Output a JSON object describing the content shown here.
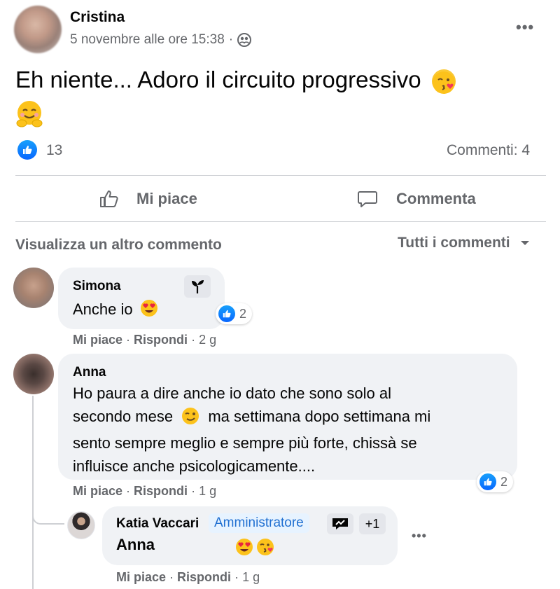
{
  "post": {
    "author": "Cristina",
    "date": "5 novembre alle ore 15:38",
    "separator": "·",
    "text_line1": "Eh niente... Adoro il circuito progressivo",
    "like_count": "13",
    "comments_count": "Commenti: 4",
    "icons": {
      "audience": "friends-icon",
      "more": "more-icon",
      "like": "like-icon"
    }
  },
  "actions": {
    "like_label": "Mi piace",
    "comment_label": "Commenta"
  },
  "comments_header": {
    "view_more": "Visualizza un altro commento",
    "filter": "Tutti i commenti"
  },
  "comments": [
    {
      "author": "Simona",
      "text": "Anche io",
      "reactions": "2",
      "like": "Mi piace",
      "reply": "Rispondi",
      "time": "2 g",
      "badge_icon": "sprout-icon"
    },
    {
      "author": "Anna",
      "text_lines": [
        "Ho paura a dire anche io dato che sono solo al",
        "secondo mese",
        "ma settimana dopo settimana mi",
        "sento sempre meglio e sempre più forte, chissà se",
        "influisce anche psicologicamente...."
      ],
      "reactions": "2",
      "like": "Mi piace",
      "reply": "Rispondi",
      "time": "1 g"
    }
  ],
  "reply": {
    "author": "Katia Vaccari",
    "badge": "Amministratore",
    "badge_extra": "+1",
    "mention": "Anna",
    "like": "Mi piace",
    "reply": "Rispondi",
    "time": "1 g"
  },
  "colors": {
    "accent": "#0866ff",
    "muted": "#65676b",
    "bubble": "#f0f2f5"
  }
}
